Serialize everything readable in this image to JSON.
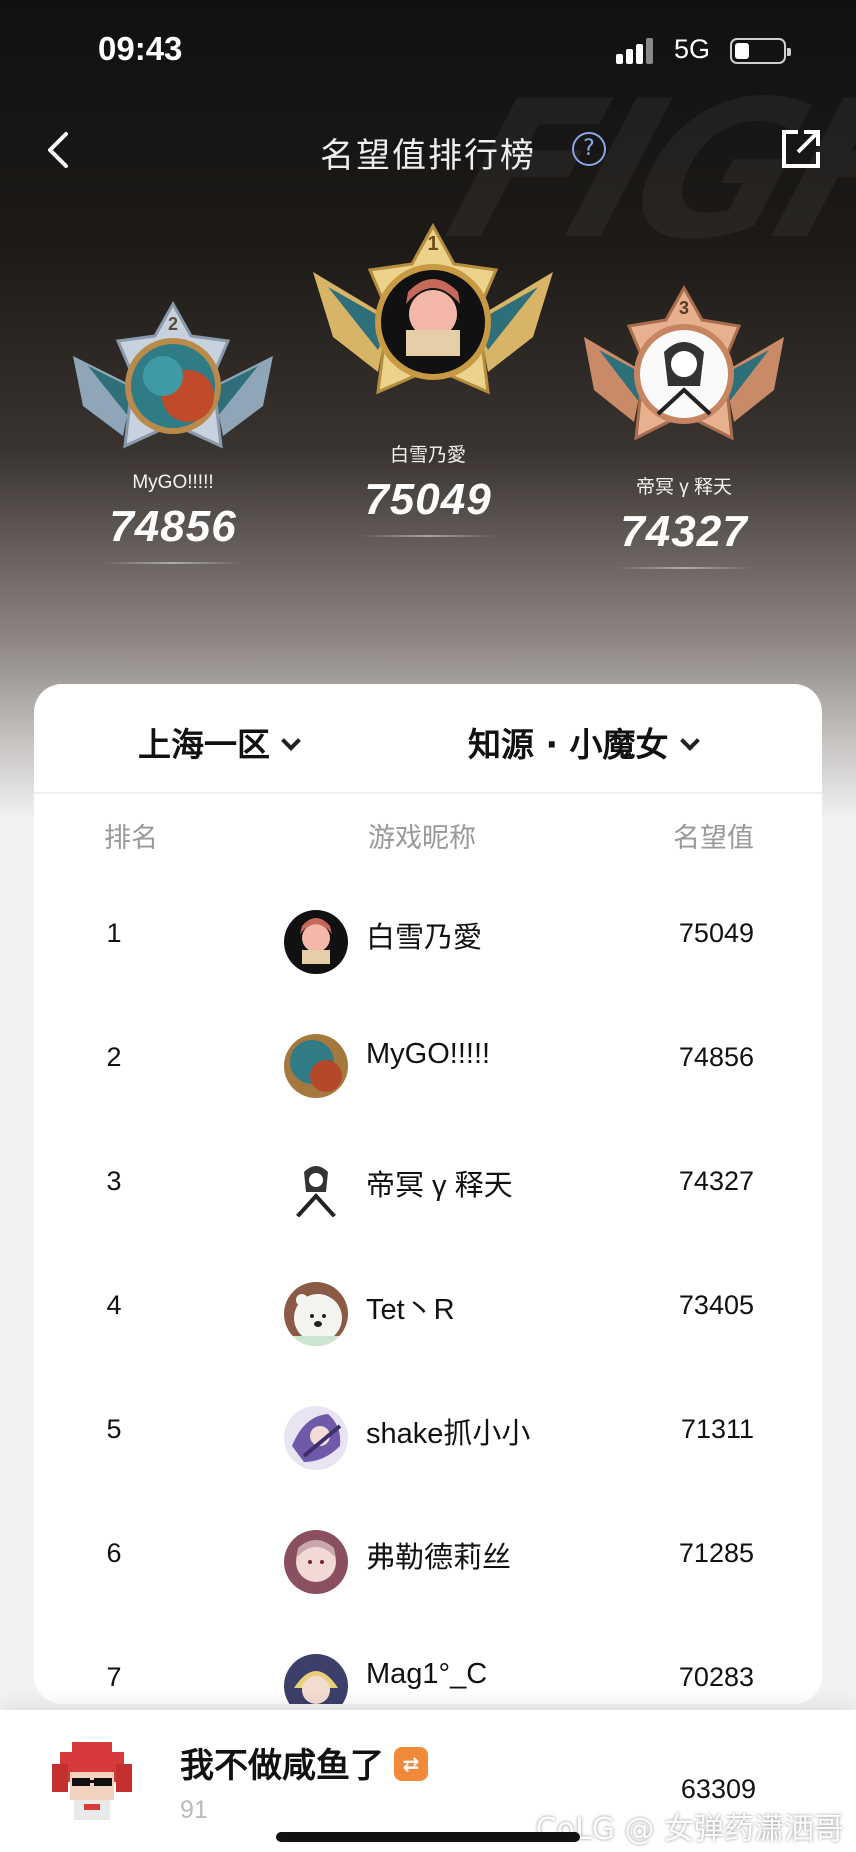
{
  "status_bar": {
    "time": "09:43",
    "network": "5G"
  },
  "nav": {
    "title": "名望值排行榜",
    "help_symbol": "?"
  },
  "podium": [
    {
      "place": "2",
      "name": "MyGO!!!!!",
      "score": "74856",
      "tier": "silver"
    },
    {
      "place": "1",
      "name": "白雪乃愛",
      "score": "75049",
      "tier": "gold"
    },
    {
      "place": "3",
      "name": "帝冥 γ 释天",
      "score": "74327",
      "tier": "bronze"
    }
  ],
  "filters": {
    "region": "上海一区",
    "hero": "知源 · 小魔女"
  },
  "table": {
    "headers": {
      "rank": "排名",
      "nickname": "游戏昵称",
      "score": "名望值"
    },
    "rows": [
      {
        "rank": "1",
        "nickname": "白雪乃愛",
        "score": "75049",
        "avatar": "anime-girl-avatar"
      },
      {
        "rank": "2",
        "nickname": "MyGO!!!!!",
        "score": "74856",
        "avatar": "teal-hair-avatar"
      },
      {
        "rank": "3",
        "nickname": "帝冥 γ 释天",
        "score": "74327",
        "avatar": "sketch-avatar"
      },
      {
        "rank": "4",
        "nickname": "Tet丶R",
        "score": "73405",
        "avatar": "white-bear-avatar"
      },
      {
        "rank": "5",
        "nickname": "shake抓小小",
        "score": "71311",
        "avatar": "purple-character-avatar"
      },
      {
        "rank": "6",
        "nickname": "弗勒德莉丝",
        "score": "71285",
        "avatar": "pink-character-avatar"
      },
      {
        "rank": "7",
        "nickname": "Mag1°_C",
        "score": "70283",
        "avatar": "blonde-character-avatar"
      }
    ]
  },
  "me": {
    "name": "我不做咸鱼了",
    "rank": "91",
    "score": "63309",
    "icon_symbol": "⇄"
  },
  "watermark": "CoLG @ 女弹药潇洒哥",
  "colors": {
    "gold": "#e3c372",
    "silver": "#b9c4d4",
    "bronze": "#d9a27f",
    "accent_orange": "#f08a3a",
    "help_blue": "#8aa6e8"
  }
}
